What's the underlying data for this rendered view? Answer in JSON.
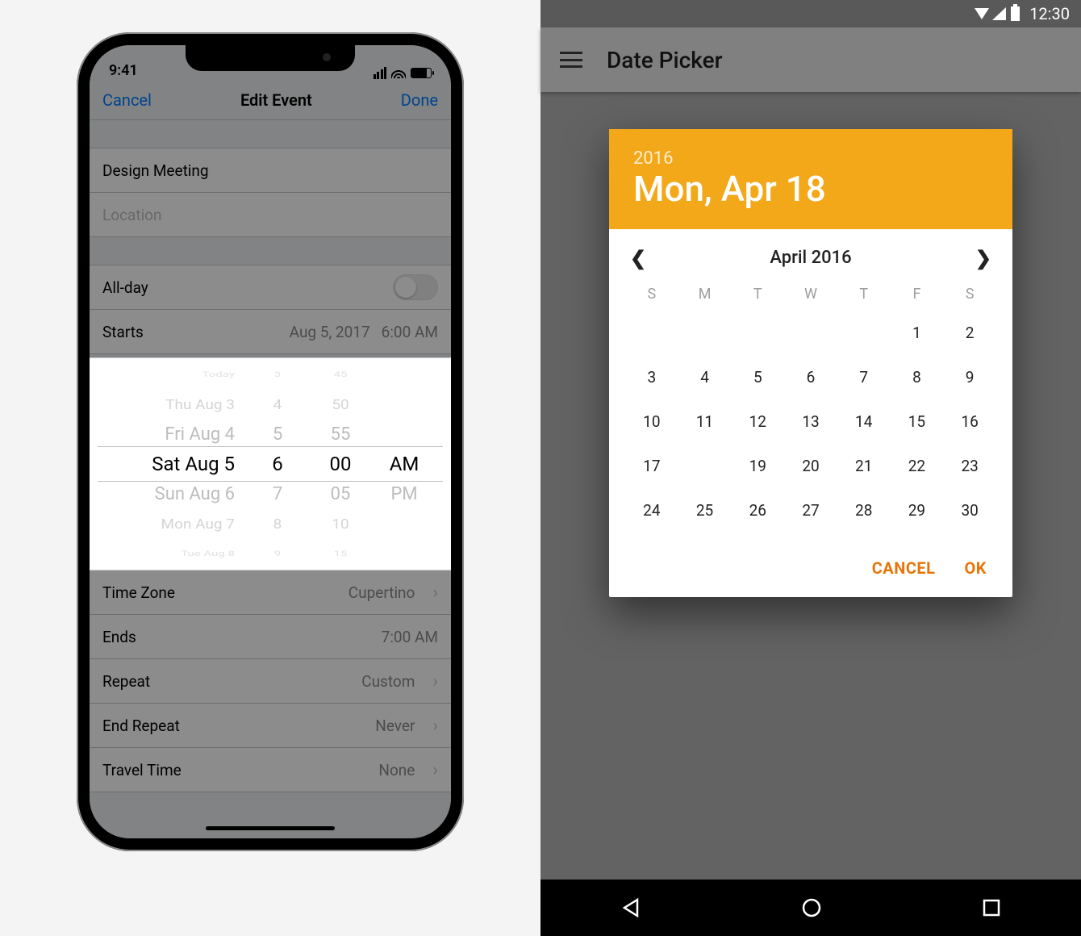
{
  "ios": {
    "status_time": "9:41",
    "nav": {
      "left": "Cancel",
      "title": "Edit Event",
      "right": "Done"
    },
    "fields": {
      "title_value": "Design Meeting",
      "location_placeholder": "Location",
      "allday_label": "All-day",
      "starts_label": "Starts",
      "starts_date": "Aug 5, 2017",
      "starts_time": "6:00 AM",
      "timezone_label": "Time Zone",
      "timezone_value": "Cupertino",
      "ends_label": "Ends",
      "ends_value": "7:00 AM",
      "repeat_label": "Repeat",
      "repeat_value": "Custom",
      "endrepeat_label": "End Repeat",
      "endrepeat_value": "Never",
      "travel_label": "Travel Time",
      "travel_value": "None"
    },
    "picker": {
      "dates": [
        "Today",
        "Thu Aug 3",
        "Fri Aug 4",
        "Sat Aug 5",
        "Sun Aug 6",
        "Mon Aug 7",
        "Tue Aug 8"
      ],
      "hours": [
        "3",
        "4",
        "5",
        "6",
        "7",
        "8",
        "9"
      ],
      "minutes": [
        "45",
        "50",
        "55",
        "00",
        "05",
        "10",
        "15"
      ],
      "ampm": [
        "",
        "",
        "",
        "AM",
        "PM",
        "",
        ""
      ],
      "selected_index": 3
    }
  },
  "android": {
    "status_time": "12:30",
    "appbar_title": "Date Picker",
    "dialog": {
      "year": "2016",
      "date_line": "Mon, Apr 18",
      "month_label": "April 2016",
      "dow": [
        "S",
        "M",
        "T",
        "W",
        "T",
        "F",
        "S"
      ],
      "leading_blanks": 5,
      "days_in_month": 30,
      "selected_day": 18,
      "actions": {
        "cancel": "CANCEL",
        "ok": "OK"
      }
    }
  }
}
